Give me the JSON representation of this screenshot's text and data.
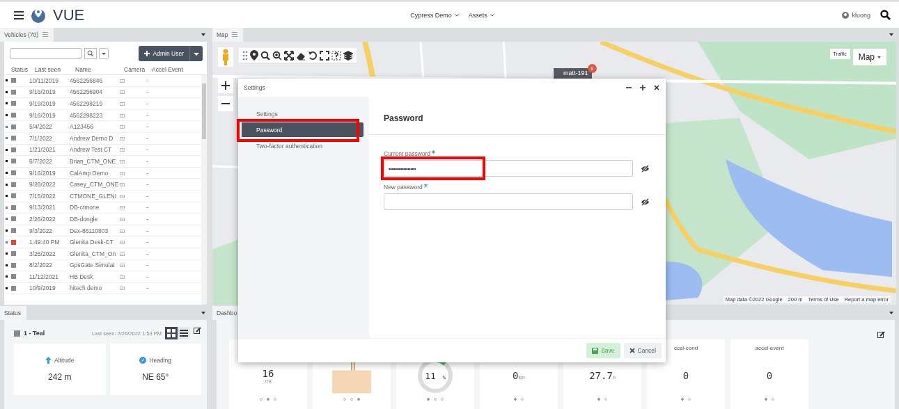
{
  "header": {
    "app_name": "VUE",
    "menus": [
      {
        "label": "Cypress Demo"
      },
      {
        "label": "Assets"
      }
    ],
    "user": "kluong"
  },
  "vehicles": {
    "tab": "Vehicles (70)",
    "admin_button": "Admin User",
    "columns": [
      "Status",
      "Last seen",
      "Name",
      "Camera",
      "Accel Event"
    ],
    "rows": [
      {
        "color": "#111111",
        "alert": false,
        "last_seen": "10/11/2019",
        "name": "4562256846",
        "accel": "-"
      },
      {
        "color": "#111111",
        "alert": false,
        "last_seen": "9/16/2019",
        "name": "4562256904",
        "accel": "-"
      },
      {
        "color": "#111111",
        "alert": false,
        "last_seen": "9/19/2019",
        "name": "4562298219",
        "accel": "-"
      },
      {
        "color": "#111111",
        "alert": false,
        "last_seen": "9/16/2019",
        "name": "4562298223",
        "accel": "-"
      },
      {
        "color": "#3b82d6",
        "alert": false,
        "last_seen": "5/4/2022",
        "name": "A123456",
        "accel": "-"
      },
      {
        "color": "#3b82d6",
        "alert": false,
        "last_seen": "7/1/2022",
        "name": "Andrew Demo D",
        "accel": "-"
      },
      {
        "color": "#111111",
        "alert": false,
        "last_seen": "1/21/2021",
        "name": "Andrew Test CT",
        "accel": "-"
      },
      {
        "color": "#111111",
        "alert": false,
        "last_seen": "6/7/2022",
        "name": "Brian_CTM_ONE",
        "accel": "-"
      },
      {
        "color": "#111111",
        "alert": false,
        "last_seen": "9/16/2019",
        "name": "CalAmp Demo",
        "accel": "-"
      },
      {
        "color": "#111111",
        "alert": false,
        "last_seen": "9/28/2022",
        "name": "Casey_CTM_ONE",
        "accel": "-"
      },
      {
        "color": "#111111",
        "alert": false,
        "last_seen": "7/15/2022",
        "name": "CTMONE_GLENI",
        "accel": "-"
      },
      {
        "color": "#e0474c",
        "alert": false,
        "last_seen": "9/13/2021",
        "name": "DB-ctmone",
        "accel": "-"
      },
      {
        "color": "#6b5bd6",
        "alert": false,
        "last_seen": "2/26/2022",
        "name": "DB-dongle",
        "accel": "-"
      },
      {
        "color": "#111111",
        "alert": false,
        "last_seen": "9/3/2022",
        "name": "Dex-86110803",
        "accel": "-"
      },
      {
        "color": "#3b82d6",
        "alert": true,
        "last_seen": "1:49:40 PM",
        "name": "Glenita Desk-CT",
        "accel": "-"
      },
      {
        "color": "#111111",
        "alert": false,
        "last_seen": "3/25/2022",
        "name": "Glenita_CTM_On",
        "accel": "-"
      },
      {
        "color": "#111111",
        "alert": false,
        "last_seen": "8/2/2022",
        "name": "GpsGate Simulat",
        "accel": "-"
      },
      {
        "color": "#111111",
        "alert": false,
        "last_seen": "11/12/2021",
        "name": "HB Desk",
        "accel": "-"
      },
      {
        "color": "#111111",
        "alert": false,
        "last_seen": "10/9/2019",
        "name": "hitech demo",
        "accel": "-"
      }
    ]
  },
  "status": {
    "tab": "Status",
    "vehicle": "1 - Teal",
    "last_seen": "Last seen: 2/26/2022 1:53 PM",
    "views": [
      {
        "kind": "grid",
        "selected": true
      },
      {
        "kind": "list",
        "selected": false
      }
    ],
    "tiles": [
      {
        "kind": "altitude",
        "label": "Altitude",
        "value": "242 m"
      },
      {
        "kind": "heading",
        "label": "Heading",
        "value": "NE 65°"
      }
    ]
  },
  "map": {
    "tab": "Map",
    "map_type": "Map",
    "traffic": "Traffic",
    "marker": {
      "label": "matt-191",
      "badge": "1"
    },
    "attribution": [
      "Map data ©2022 Google",
      "200 m",
      "Terms of Use",
      "Report a map error"
    ]
  },
  "dashboard": {
    "tab": "Dashbo",
    "tiles": [
      {
        "kind": "count",
        "value": "16",
        "sub": "/78",
        "dots": [
          false,
          true,
          false
        ]
      },
      {
        "kind": "bar",
        "dots": [
          false,
          false,
          true
        ]
      },
      {
        "kind": "donut",
        "value": "11",
        "unit": "%",
        "dots": [
          true,
          false,
          false
        ]
      },
      {
        "kind": "number",
        "value": "0",
        "unit": "km",
        "dots": [
          true,
          false
        ]
      },
      {
        "kind": "number",
        "value": "27.7",
        "unit": "h",
        "dots": [
          true,
          false
        ]
      },
      {
        "kind": "number",
        "title": "ccel-cond",
        "value": "0",
        "dots": [
          true,
          false
        ]
      },
      {
        "kind": "number",
        "title": "accel-event",
        "value": "0",
        "dots": [
          true,
          false
        ]
      }
    ]
  },
  "dialog": {
    "title": "Settings",
    "nav": [
      {
        "label": "Settings",
        "selected": false
      },
      {
        "label": "Password",
        "selected": true
      },
      {
        "label": "Two-factor authentication",
        "selected": false
      }
    ],
    "heading": "Password",
    "fields": [
      {
        "label": "Current password",
        "required": true,
        "value": "••••••••••••••••••••"
      },
      {
        "label": "New password",
        "required": true
      }
    ],
    "buttons": [
      {
        "kind": "save",
        "label": "Save",
        "disabled": true
      },
      {
        "kind": "cancel",
        "label": "Cancel"
      }
    ]
  }
}
